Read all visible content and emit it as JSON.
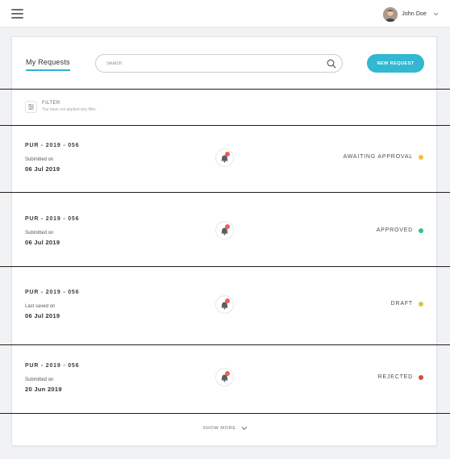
{
  "topbar": {
    "menu_icon": "hamburger-menu-icon",
    "user": {
      "name": "John Doe",
      "avatar_icon": "avatar-icon",
      "dropdown_icon": "chevron-down-icon"
    }
  },
  "main": {
    "tab_label": "My Requests",
    "search": {
      "placeholder": "Search",
      "value": "",
      "icon": "search-icon"
    },
    "new_request_label": "NEW REQUEST",
    "accent_color": "#2cb5cf",
    "filter": {
      "icon": "sliders-icon",
      "title": "FILTER",
      "subtitle": "You have not applied any filter."
    },
    "requests": [
      {
        "id": "PUR - 2019 - 056",
        "label": "Submitted on",
        "date": "06 Jul 2019",
        "status": "AWAITING APPROVAL",
        "status_color": "#f2c037",
        "bell_icon": "bell-icon"
      },
      {
        "id": "PUR - 2019 - 056",
        "label": "Submitted on",
        "date": "06 Jul 2019",
        "status": "APPROVED",
        "status_color": "#2fc47a",
        "bell_icon": "bell-icon"
      },
      {
        "id": "PUR - 2019 - 056",
        "label": "Last saved on",
        "date": "06 Jul 2019",
        "status": "DRAFT",
        "status_color": "#d8c444",
        "bell_icon": "bell-icon"
      },
      {
        "id": "PUR - 2019 - 056",
        "label": "Submitted on",
        "date": "20 Jun 2019",
        "status": "REJECTED",
        "status_color": "#dd4a3c",
        "bell_icon": "bell-icon"
      }
    ],
    "show_more_label": "SHOW MORE"
  }
}
